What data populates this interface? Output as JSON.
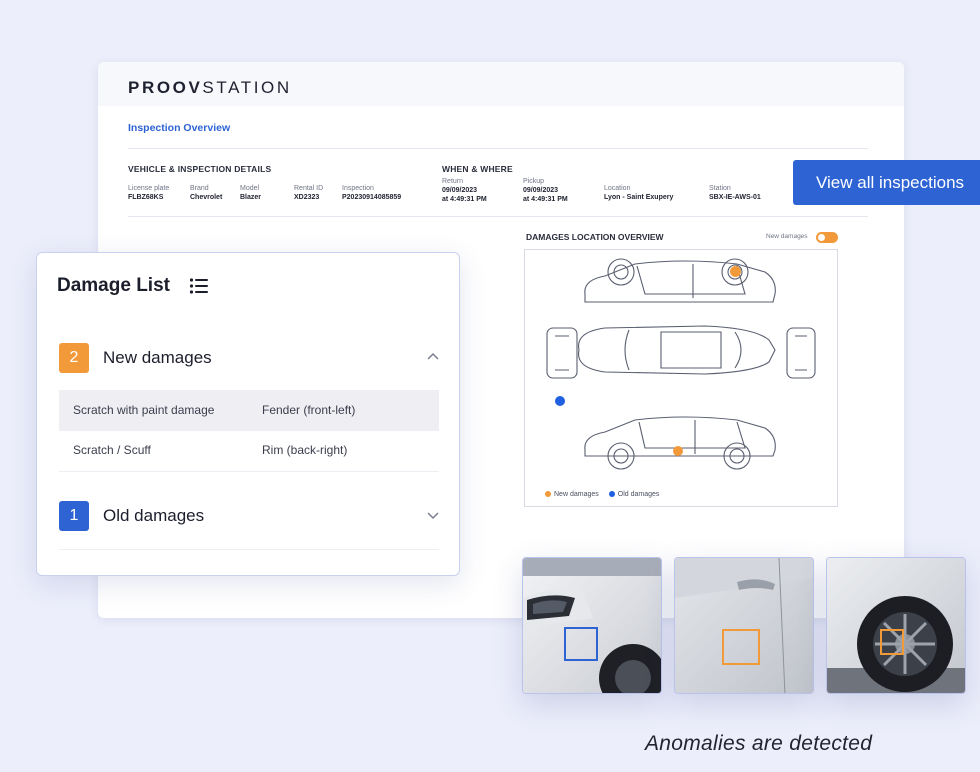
{
  "report": {
    "logo_bold": "PROOV",
    "logo_rest": "STATION",
    "breadcrumb": "Inspection Overview",
    "vehicle_section_title": "VEHICLE & INSPECTION DETAILS",
    "when_section_title": "WHEN & WHERE",
    "vehicle_fields": [
      {
        "label": "License plate",
        "value": "FLBZ68KS"
      },
      {
        "label": "Brand",
        "value": "Chevrolet"
      },
      {
        "label": "Model",
        "value": "Blazer"
      },
      {
        "label": "Rental ID",
        "value": "XD2323"
      },
      {
        "label": "Inspection",
        "value": "P20230914085859"
      }
    ],
    "when_fields": [
      {
        "label": "Return",
        "value": "09/09/2023",
        "value2": "at 4:49:31 PM"
      },
      {
        "label": "Pickup",
        "value": "09/09/2023",
        "value2": "at 4:49:31 PM"
      },
      {
        "label": "Location",
        "value": "Lyon - Saint Exupery",
        "value2": ""
      },
      {
        "label": "Station",
        "value": "SBX-IE-AWS-01",
        "value2": ""
      }
    ],
    "damages_overview_title": "DAMAGES LOCATION OVERVIEW",
    "toggle_label": "New damages",
    "legend_new": "New damages",
    "legend_old": "Old damages"
  },
  "cta_label": "View all inspections",
  "damage_list": {
    "title": "Damage List",
    "new_group": {
      "count": "2",
      "title": "New damages"
    },
    "new_rows": [
      {
        "type": "Scratch with paint damage",
        "location": "Fender (front-left)"
      },
      {
        "type": "Scratch / Scuff",
        "location": "Rim (back-right)"
      }
    ],
    "old_group": {
      "count": "1",
      "title": "Old damages"
    }
  },
  "caption": "Anomalies are detected",
  "colors": {
    "accent_blue": "#2e63d4",
    "new_orange": "#f29a3a",
    "old_blue": "#1f5fe0",
    "background": "#eceefb"
  }
}
